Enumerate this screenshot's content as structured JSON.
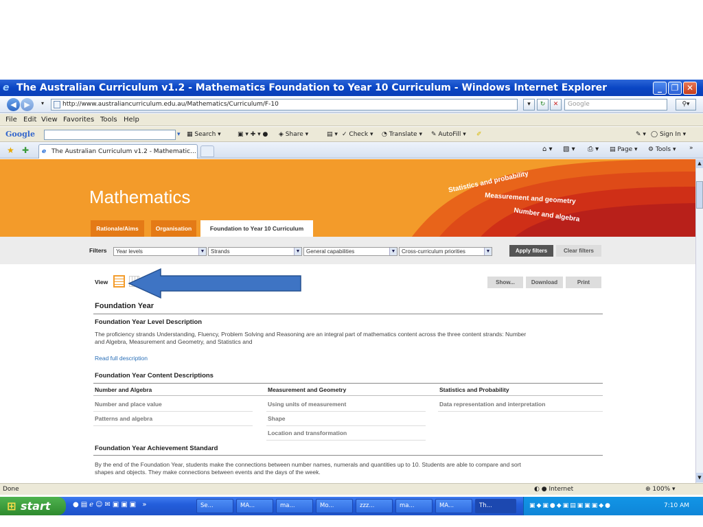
{
  "window": {
    "title": "The Australian Curriculum v1.2 - Mathematics Foundation to Year 10 Curriculum - Windows Internet Explorer"
  },
  "navbar": {
    "url": "http://www.australiancurriculum.edu.au/Mathematics/Curriculum/F-10",
    "search_placeholder": "Google"
  },
  "menu": [
    "File",
    "Edit",
    "View",
    "Favorites",
    "Tools",
    "Help"
  ],
  "googlebar": {
    "logo": "Google",
    "items": [
      "Search",
      "Share",
      "Check",
      "Translate",
      "AutoFill"
    ],
    "signin": "Sign In"
  },
  "tabs": {
    "active_label": "The Australian Curriculum v1.2 - Mathematic...",
    "tools": [
      "Page",
      "Tools"
    ]
  },
  "hero": {
    "title": "Mathematics",
    "tabs": [
      "Rationale/Aims",
      "Organisation",
      "Foundation to Year 10 Curriculum"
    ],
    "strands": [
      "Statistics and probability",
      "Measurement and geometry",
      "Number and algebra"
    ]
  },
  "filters": {
    "label": "Filters",
    "selects": [
      "Year levels",
      "Strands",
      "General capabilities",
      "Cross-curriculum priorities"
    ],
    "apply": "Apply filters",
    "clear": "Clear filters"
  },
  "view": {
    "label": "View",
    "show": "Show...",
    "download": "Download",
    "print": "Print"
  },
  "foundation": {
    "heading": "Foundation Year",
    "level_heading": "Foundation Year Level Description",
    "level_text_1": "The proficiency strands Understanding, Fluency, Problem Solving and Reasoning are an integral part of mathematics content across the three content strands: Number",
    "level_text_2": "and Algebra, Measurement and Geometry, and Statistics and",
    "read_more": "Read full description",
    "content_heading": "Foundation Year Content Descriptions",
    "columns": [
      {
        "header": "Number and Algebra",
        "items": [
          "Number and place value",
          "Patterns and algebra"
        ]
      },
      {
        "header": "Measurement and Geometry",
        "items": [
          "Using units of measurement",
          "Shape",
          "Location and transformation"
        ]
      },
      {
        "header": "Statistics and Probability",
        "items": [
          "Data representation and interpretation"
        ]
      }
    ],
    "achievement_heading": "Foundation Year Achievement Standard",
    "achievement_text_1": "By the end of the Foundation Year, students make the connections between number names, numerals and quantities up to 10. Students are able to compare and sort",
    "achievement_text_2": "shapes and objects. They make connections between events and the days of the week."
  },
  "statusbar": {
    "left": "Done",
    "zone": "Internet",
    "zoom": "100%"
  },
  "taskbar": {
    "start": "start",
    "buttons": [
      "Se...",
      "MA...",
      "ma...",
      "Mo...",
      "zzz...",
      "ma...",
      "MA...",
      "Th..."
    ],
    "clock": "7:10 AM"
  },
  "colors": {
    "orange": "#f39b2a",
    "xp_blue": "#245edb",
    "arrow_blue": "#3e74c4"
  }
}
